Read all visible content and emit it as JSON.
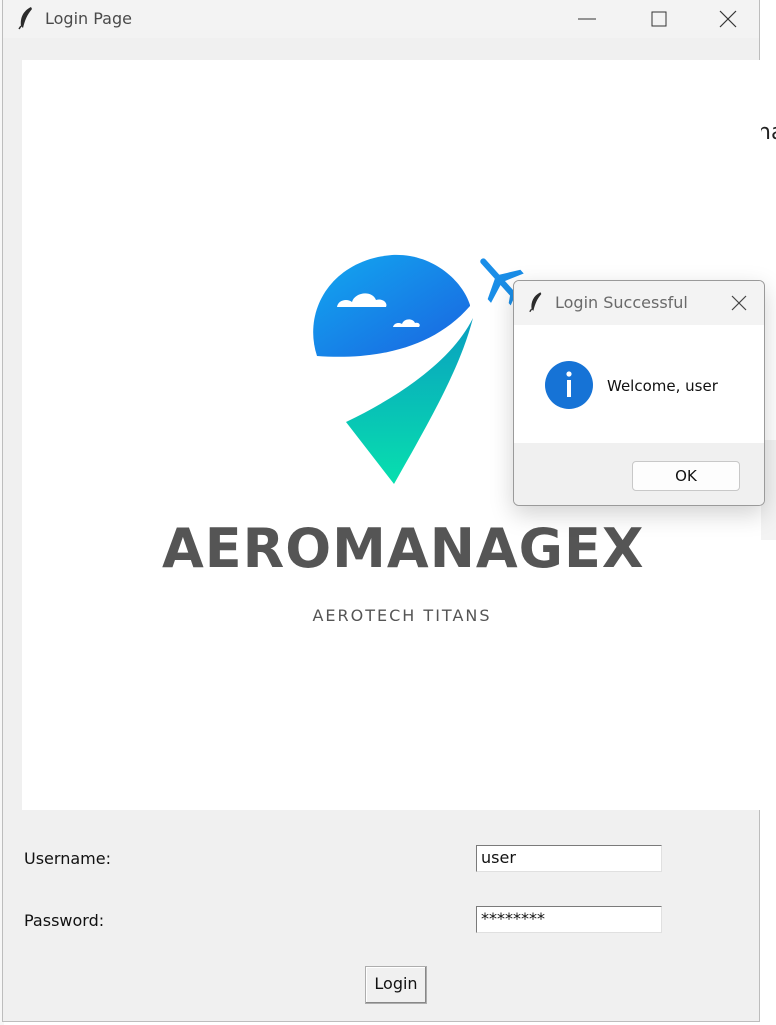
{
  "window": {
    "title": "Login Page"
  },
  "brand": {
    "name": "AEROMANAGEX",
    "tagline": "AEROTECH TITANS"
  },
  "form": {
    "username_label": "Username:",
    "username_value": "user",
    "password_label": "Password:",
    "password_value": "********",
    "login_label": "Login"
  },
  "dialog": {
    "title": "Login Successful",
    "message": "Welcome, user",
    "ok_label": "OK",
    "icon": "info-icon"
  },
  "background": {
    "fragment_text": "na"
  },
  "colors": {
    "logo_blue": "#1a7fe8",
    "logo_teal": "#07d9b0",
    "info_blue": "#1673d6",
    "brand_gray": "#555555"
  }
}
